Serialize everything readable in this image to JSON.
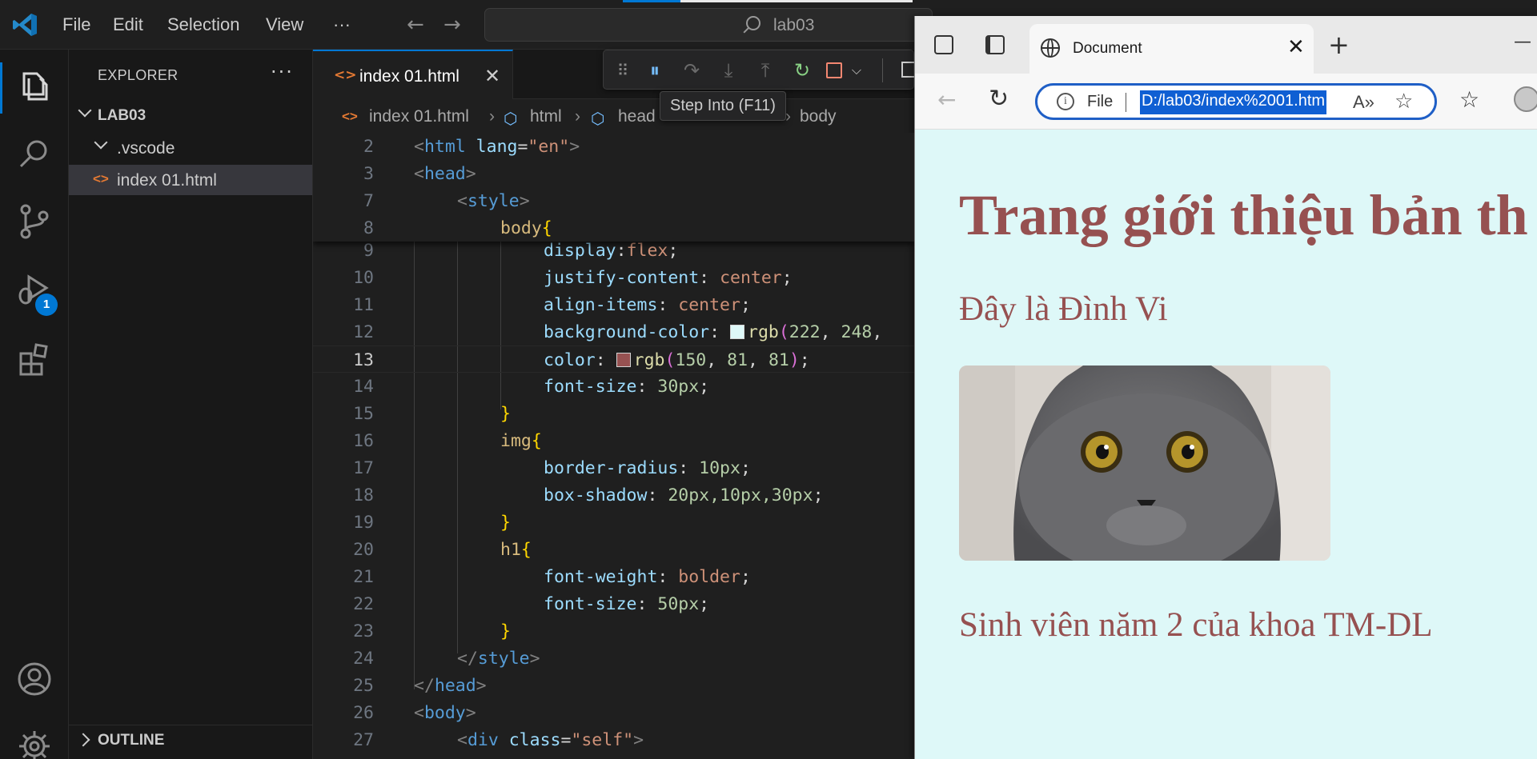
{
  "titlebar": {
    "menu": [
      "File",
      "Edit",
      "Selection",
      "View",
      "···"
    ],
    "command_center": "lab03"
  },
  "activity": {
    "debug_badge": "1"
  },
  "sidebar": {
    "title": "EXPLORER",
    "more": "···",
    "root": "LAB03",
    "items": [
      ".vscode",
      "index 01.html"
    ],
    "outline": "OUTLINE"
  },
  "editor": {
    "tab_label": "index 01.html",
    "tooltip": "Step Into (F11)",
    "breadcrumb": [
      "index 01.html",
      "html",
      "head",
      "body"
    ],
    "current_line": "13"
  },
  "code_lines": [
    {
      "n": "2"
    },
    {
      "n": "3"
    },
    {
      "n": "7"
    },
    {
      "n": "8"
    },
    {
      "n": "9"
    },
    {
      "n": "10"
    },
    {
      "n": "11"
    },
    {
      "n": "12"
    },
    {
      "n": "13"
    },
    {
      "n": "14"
    },
    {
      "n": "15"
    },
    {
      "n": "16"
    },
    {
      "n": "17"
    },
    {
      "n": "18"
    },
    {
      "n": "19"
    },
    {
      "n": "20"
    },
    {
      "n": "21"
    },
    {
      "n": "22"
    },
    {
      "n": "23"
    },
    {
      "n": "24"
    },
    {
      "n": "25"
    },
    {
      "n": "26"
    },
    {
      "n": "27"
    }
  ],
  "code": {
    "l2": [
      "<",
      "html",
      " lang",
      "=",
      "\"en\"",
      ">"
    ],
    "l3": [
      "<",
      "head",
      ">"
    ],
    "l7": [
      "<",
      "style",
      ">"
    ],
    "l8": [
      "body",
      "{"
    ],
    "l9": [
      "display",
      ":",
      "flex",
      ";"
    ],
    "l10": [
      "justify-content",
      ": ",
      "center",
      ";"
    ],
    "l11": [
      "align-items",
      ": ",
      "center",
      ";"
    ],
    "l12": [
      "background-color",
      ": ",
      "rgb",
      "(",
      "222",
      ", ",
      "248",
      ","
    ],
    "l13": [
      "color",
      ": ",
      "rgb",
      "(",
      "150",
      ", ",
      "81",
      ", ",
      "81",
      ")",
      ";"
    ],
    "l14": [
      "font-size",
      ": ",
      "30px",
      ";"
    ],
    "l15": [
      "}"
    ],
    "l16": [
      "img",
      "{"
    ],
    "l17": [
      "border-radius",
      ": ",
      "10px",
      ";"
    ],
    "l18": [
      "box-shadow",
      ": ",
      "20px,10px,30px",
      ";"
    ],
    "l19": [
      "}"
    ],
    "l20": [
      "h1",
      "{"
    ],
    "l21": [
      "font-weight",
      ": ",
      "bolder",
      ";"
    ],
    "l22": [
      "font-size",
      ": ",
      "50px",
      ";"
    ],
    "l23": [
      "}"
    ],
    "l24": [
      "</",
      "style",
      ">"
    ],
    "l25": [
      "</",
      "head",
      ">"
    ],
    "l26": [
      "<",
      "body",
      ">"
    ],
    "l27": [
      "<",
      "div",
      " class",
      "=",
      "\"self\"",
      ">"
    ]
  },
  "swatches": {
    "bg": "#def8f8",
    "fg": "#965151"
  },
  "browser": {
    "tab_title": "Document",
    "scheme": "File",
    "url": "D:/lab03/index%2001.htm",
    "page": {
      "heading": "Trang giới thiệu bản th",
      "intro": "Đây là Đình Vi",
      "description": "Sinh viên năm 2 của khoa TM-DL",
      "image": "cat-photo"
    }
  },
  "colors": {
    "accent": "#0078d4",
    "page_bg": "#def8f8",
    "page_text": "#965151"
  }
}
